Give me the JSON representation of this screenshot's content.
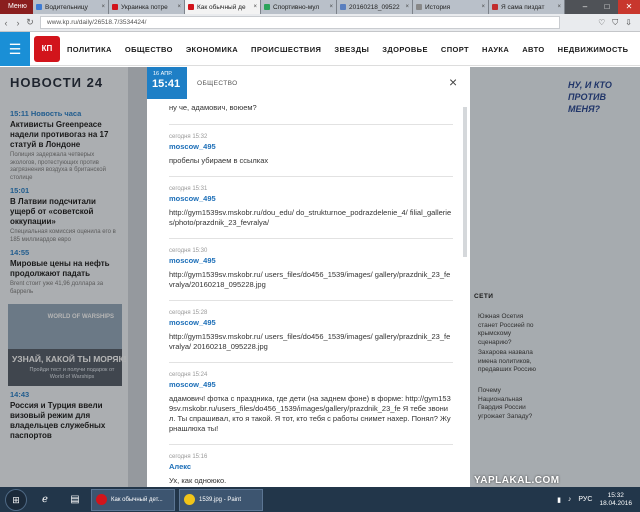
{
  "browser": {
    "menu_label": "Меню",
    "tabs": [
      {
        "label": "Водительницу",
        "color": "#3d7bd4"
      },
      {
        "label": "Украинка потре",
        "color": "#d2141b"
      },
      {
        "label": "Как обычный де",
        "color": "#d2141b",
        "active": true
      },
      {
        "label": "Спортивно-мул",
        "color": "#2aa35a"
      },
      {
        "label": "20160218_09522",
        "color": "#5a7fbf"
      },
      {
        "label": "История",
        "color": "#888888"
      },
      {
        "label": "Я сама пиздат",
        "color": "#c22d2d"
      }
    ],
    "url": "www.kp.ru/daily/26518.7/3534424/"
  },
  "site": {
    "logo_text": "КП",
    "nav": [
      "ПОЛИТИКА",
      "ОБЩЕСТВО",
      "ЭКОНОМИКА",
      "ПРОИСШЕСТВИЯ",
      "ЗВЕЗДЫ",
      "ЗДОРОВЬЕ",
      "СПОРТ",
      "НАУКА",
      "АВТО",
      "НЕДВИЖИМОСТЬ"
    ]
  },
  "news24": {
    "title": "НОВОСТИ 24",
    "items": [
      {
        "time": "15:11 Новость часа",
        "headline": "Активисты Greenpeace надели противогаз на 17 статуй в Лондоне",
        "lead": "Полиция задержала четверых экологов, протестующих против загрязнения воздуха в британской столице"
      },
      {
        "time": "15:01",
        "headline": "В Латвии подсчитали ущерб от «советской оккупации»",
        "lead": "Специальная комиссия оценила его в 185 миллиардов евро"
      },
      {
        "time": "14:55",
        "headline": "Мировые цены на нефть продолжают падать",
        "lead": "Brent стоит уже 41,96 доллара за баррель"
      }
    ],
    "banner": {
      "line1": "УЗНАЙ, КАКОЙ ТЫ МОРЯК!",
      "line2": "Пройди тест и получи подарок от World of Warships",
      "brand": "WORLD OF WARSHIPS"
    },
    "items2": [
      {
        "time": "14:43",
        "headline": "Россия и Турция ввели визовый режим для владельцев служебных паспортов",
        "lead": ""
      }
    ]
  },
  "right": {
    "doodle": "НУ, И КТО ПРОТИВ МЕНЯ?",
    "section": "СЕТИ",
    "items": [
      "Южная Осетия станет Россией по крымскому сценарию?",
      "Захарова назвала имена политиков, предавших Россию",
      "Почему Национальная Гвардия России угрожает Западу?"
    ]
  },
  "modal": {
    "date_day": "16 АПР.",
    "date_time": "15:41",
    "rubric": "ОБЩЕСТВО",
    "close": "×",
    "first_line": "ну че, адамович, воюем?",
    "comments": [
      {
        "meta": "сегодня 15:32",
        "author": "moscow_495",
        "text": "пробелы убираем в ссылках"
      },
      {
        "meta": "сегодня 15:31",
        "author": "moscow_495",
        "text": "http://gym1539sv.mskobr.ru/dou_edu/ do_strukturnoe_podrazdelenie_4/ filial_galleries/photo/prazdnik_23_fevralya/"
      },
      {
        "meta": "сегодня 15:30",
        "author": "moscow_495",
        "text": "http://gym1539sv.mskobr.ru/ users_files/do456_1539/images/ gallery/prazdnik_23_fevralya/20160218_095228.jpg"
      },
      {
        "meta": "сегодня 15:28",
        "author": "moscow_495",
        "text": "http://gym1539sv.mskobr.ru/ users_files/do456_1539/images/ gallery/prazdnik_23_fevralya/ 20160218_095228.jpg"
      },
      {
        "meta": "сегодня 15:24",
        "author": "moscow_495",
        "text": "адамович! фотка с праздника, где дети (на заднем фоне) в форме: http://gym1539sv.mskobr.ru/users_files/do456_1539/images/gallery/prazdnik_23_fe Я тебе звонил. Ты спрашивал, кто я такой. Я тот, кто тебя с работы снимет нахер. Понял? Журнашлюха ты!"
      },
      {
        "meta": "сегодня 15:16",
        "author": "Алекс",
        "text": "Ух, как одноюко."
      }
    ]
  },
  "taskbar": {
    "buttons": [
      {
        "label": "Как обычный дет...",
        "color": "#d2141b"
      },
      {
        "label": "1539.jpg - Paint",
        "color": "#f0c419"
      }
    ],
    "lang": "РУС",
    "time": "15:32",
    "date": "18.04.2016"
  },
  "watermark": "YAPLAKAL.COM"
}
